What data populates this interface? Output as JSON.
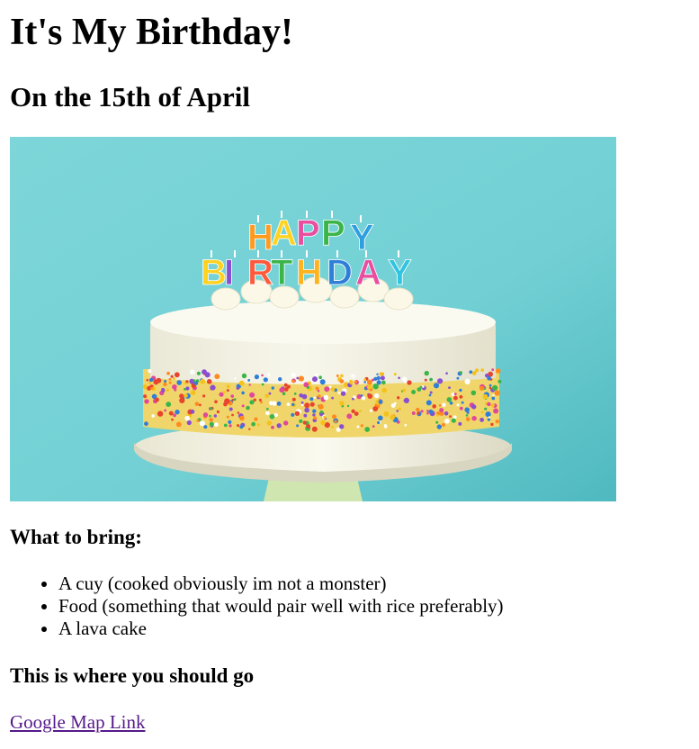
{
  "heading": "It's My Birthday!",
  "subheading": "On the 15th of April",
  "image": {
    "cake_candles": [
      "H",
      "A",
      "P",
      "P",
      "Y",
      "B",
      "I",
      "R",
      "T",
      "H",
      "D",
      "A",
      "Y"
    ]
  },
  "bring": {
    "title": "What to bring:",
    "items": [
      "A cuy (cooked obviously im not a monster)",
      "Food (something that would pair well with rice preferably)",
      "A lava cake"
    ]
  },
  "directions": {
    "title": "This is where you should go",
    "link_label": "Google Map Link"
  },
  "colors": {
    "background": "#ffffff",
    "text": "#000000",
    "visited_link": "#551a8b",
    "image_background": "#74d2d6"
  }
}
